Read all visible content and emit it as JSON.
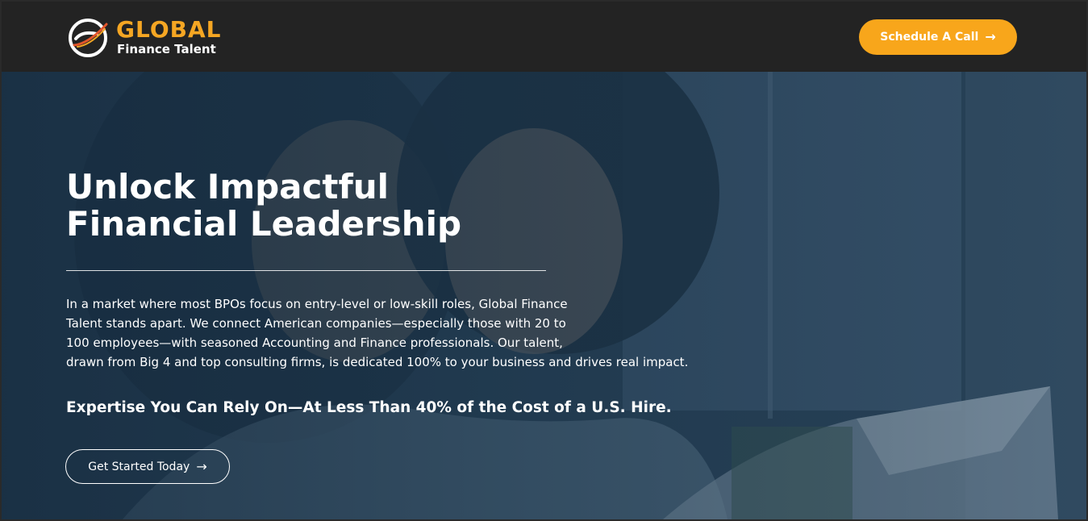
{
  "header": {
    "logo": {
      "name": "GLOBAL",
      "subtitle": "Finance Talent",
      "icon": "globe-e-icon"
    },
    "cta": {
      "label": "Schedule A Call",
      "icon": "arrow-right-icon"
    }
  },
  "hero": {
    "title_lines": [
      "Unlock Impactful",
      "Financial Leadership"
    ],
    "paragraph_lines": [
      "In a market where most BPOs focus on entry-level or low-skill roles, Global Finance",
      "Talent stands apart. We connect American companies—especially those with 20 to",
      "100 employees—with seasoned Accounting and Finance professionals. Our talent,",
      "drawn from Big 4 and top consulting firms, is dedicated 100% to your business and drives real impact."
    ],
    "tagline": "Expertise You Can Rely On—At Less Than 40% of the Cost of a U.S. Hire.",
    "cta": {
      "label": "Get Started Today",
      "icon": "arrow-right-icon"
    }
  },
  "colors": {
    "accent": "#f8a61b",
    "header_bg": "#232323",
    "hero_overlay": "#1f3a52",
    "text": "#ffffff"
  }
}
